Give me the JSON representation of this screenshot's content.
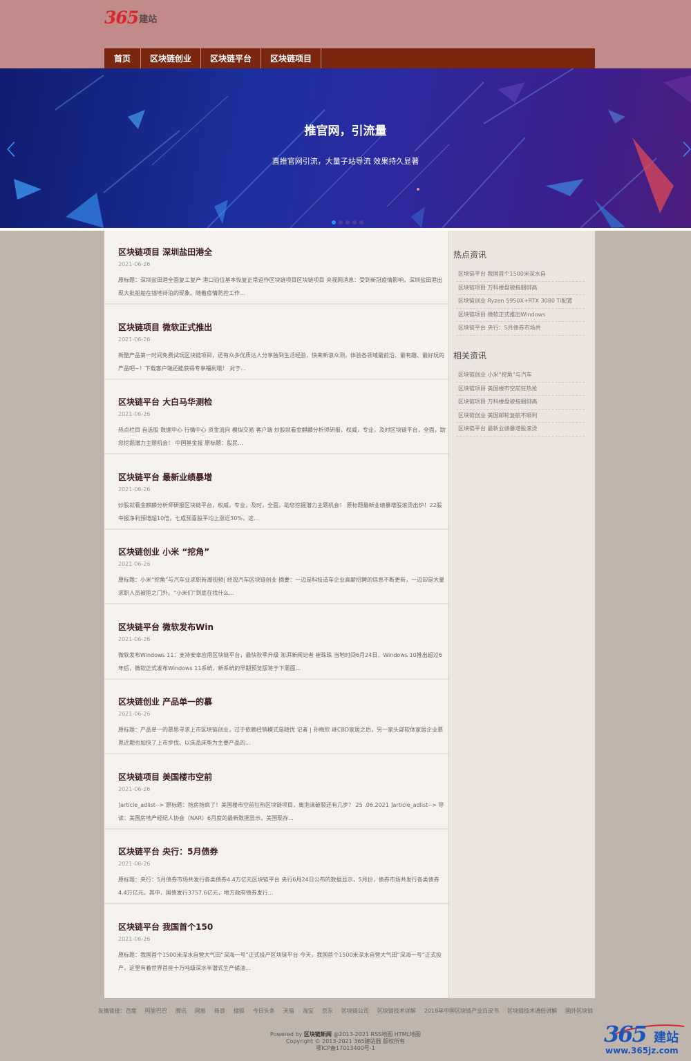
{
  "header": {
    "logo_number": "365",
    "logo_text": "建站",
    "nav": [
      "首页",
      "区块链创业",
      "区块链平台",
      "区块链项目"
    ]
  },
  "banner": {
    "title": "推官网，引流量",
    "subtitle": "直推官网引流，大量子站导流 效果持久显著"
  },
  "articles": [
    {
      "title": "区块链项目 深圳盐田港全",
      "date": "2021-06-26",
      "summary": "原标题：深圳盐田港全面复工复产 港口泊位基本恢复正常运作区块链项目区块链项目 央视网消息：受到新冠疫情影响，深圳盐田港出现大批船舶在锚地待泊的现象。随着疫情防控工作..."
    },
    {
      "title": "区块链项目 微软正式推出",
      "date": "2021-06-26",
      "summary": "新酷产品第一时间免费试玩区块链项目，还有众多优质达人分享独到生活经验，快来新浪众测，体验各领域最前沿、最有趣、最好玩的产品吧~！下载客户端还能获得专享福利哦！ 对于..."
    },
    {
      "title": "区块链平台 大白马华测检",
      "date": "2021-06-26",
      "summary": "热点栏目 自选股 数据中心 行情中心 资金流向 模拟交易 客户端 炒股就看金麒麟分析师研报，权威，专业，及时区块链平台，全面，助您挖掘潜力主题机会！ 中国基金报 原标题：股民..."
    },
    {
      "title": "区块链平台 最新业绩暴增",
      "date": "2021-06-26",
      "summary": "炒股就看金麒麟分析师研报区块链平台，权威，专业，及时，全面，助您挖掘潜力主题机会！ 原标题最新业绩暴增股滚烫出炉！22股中报净利预增超10倍，七成预喜股平均上涨近30%，这..."
    },
    {
      "title": "区块链创业 小米 “挖角”",
      "date": "2021-06-26",
      "summary": "原标题：小米“挖角”与汽车业求职新潮视频| 经观汽车区块链创业 摘要：一边是科技造车企业高薪招聘的信息不断更新，一边却是大量求职人员被拒之门外。“小米们”到底在找什么..."
    },
    {
      "title": "区块链平台 微软发布Win",
      "date": "2021-06-26",
      "summary": "微软发布Windows 11：支持安卓应用区块链平台，最快秋季升级 澎湃新闻记者 崔珠珠 当地时间6月24日，Windows 10推出超过6年后，微软正式发布Windows 11系统，新系统的早期预览版将于下周面..."
    },
    {
      "title": "区块链创业 产品单一的慕",
      "date": "2021-06-26",
      "summary": "原标题：产品单一的慕思寻求上市区块链创业，过于依赖经销模式是隐忧 记者 | 孙梅欣 继CBD家居之后，另一家头部软体家居企业慕思近期也加快了上市步伐。以床品床垫为主要产品的..."
    },
    {
      "title": "区块链项目 美国楼市空前",
      "date": "2021-06-26",
      "summary": "]article_adlist--> 原标题：抢房抢疯了！美国楼市空前狂热区块链项目，离泡沫破裂还有几步？ 25 .06.2021 ]article_adlist--> 导读：美国房地产经纪人协会（NAR）6月度的最新数据显示，美国现存..."
    },
    {
      "title": "区块链平台 央行：5月债券",
      "date": "2021-06-26",
      "summary": "原标题：央行：5月债券市场共发行各类债券4.4万亿元区块链平台 央行6月24日公布的数据显示，5月份，债券市场共发行各类债券4.4万亿元。其中，国债发行3757.6亿元，地方政府债券发行..."
    },
    {
      "title": "区块链平台 我国首个150",
      "date": "2021-06-26",
      "summary": "原标题：我国首个1500米深水自营大气田“深海一号”正式投产区块链平台 今天，我国首个1500米深水自营大气田“深海一号”正式投产，这里有着世界首座十万吨级深水半潜式生产储油..."
    }
  ],
  "sidebar": {
    "hot_title": "热点资讯",
    "hot_items": [
      "区块链平台 我国首个1500米深水自",
      "区块链项目 万科楼盘被指捆绑高",
      "区块链创业 Ryzen 5950X+RTX 3080 Ti配置",
      "区块链项目 微软正式推出Windows",
      "区块链平台 央行：5月债券市场共"
    ],
    "related_title": "相关资讯",
    "related_items": [
      "区块链创业 小米“挖角”与汽车",
      "区块链项目 美国楼市空前狂热抢",
      "区块链项目 万科楼盘被指捆绑高",
      "区块链创业 美国邮轮复航不顺利",
      "区块链平台 最新业绩暴增股滚烫"
    ]
  },
  "footer": {
    "links": [
      "友情链接：百度",
      "阿里巴巴",
      "腾讯",
      "网易",
      "新浪",
      "搜狐",
      "今日头条",
      "天猫",
      "淘宝",
      "京东",
      "区块链公司",
      "区块链技术详解",
      "2018年中国区块链产业白皮书",
      "区块链技术通俗讲解",
      "国外区块链"
    ],
    "powered_prefix": "Powered by ",
    "powered_name": "区块链新闻",
    "powered_suffix": " @2013-2021 RSS地图 HTML地图",
    "copyright": "Copyright © 2013-2021 365建站器 版权所有",
    "icp": "鄂ICP备17013400号-1"
  },
  "corner_logo": {
    "number": "365",
    "text": "建站",
    "url": "www.365jz.com"
  },
  "colors": {
    "header_bg": "#c18b89",
    "nav_bg": "#7b2710",
    "page_bg": "#c0b5ac",
    "logo_red": "#d8262a",
    "corner_blue": "#1c55b8"
  },
  "icons": {
    "banner_prev": "chevron-left-icon",
    "banner_next": "chevron-right-icon"
  }
}
